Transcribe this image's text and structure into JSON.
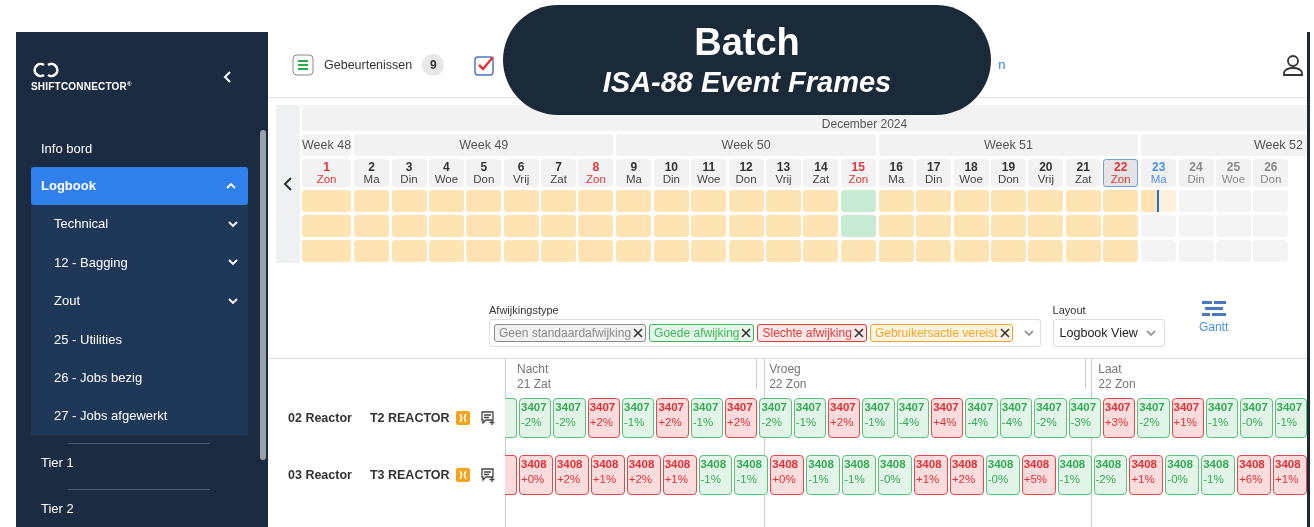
{
  "banner": {
    "title": "Batch",
    "subtitle": "ISA-88 Event Frames"
  },
  "sidebar": {
    "logo": "SHIFTCONNECTOR$^{®}$",
    "items": [
      {
        "label": "Info bord",
        "selected": false
      },
      {
        "label": "Logbook",
        "selected": true,
        "expanded": true,
        "children": [
          {
            "label": "Technical",
            "expandable": true
          },
          {
            "label": "12 - Bagging",
            "expandable": true
          },
          {
            "label": "Zout",
            "expandable": true
          },
          {
            "label": "25 - Utilities",
            "expandable": false
          },
          {
            "label": "26 - Jobs bezig",
            "expandable": false
          },
          {
            "label": "27 - Jobs afgewerkt",
            "expandable": false
          }
        ]
      },
      {
        "label": "Tier 1",
        "selected": false
      },
      {
        "label": "Tier 2",
        "selected": false
      }
    ]
  },
  "toolbar": {
    "events": {
      "label": "Gebeurtenissen",
      "count": "9"
    },
    "link_fragment": "n"
  },
  "calendar": {
    "month": "December 2024",
    "weeks": [
      {
        "label": "Week 48",
        "days": [
          {
            "num": "1",
            "name": "Zon",
            "kind": "sunday",
            "selected": false,
            "cells": [
              {
                "color": "#fee3b3"
              },
              {
                "color": "#fee3b3"
              },
              {
                "color": "#fee3b3"
              }
            ]
          }
        ]
      },
      {
        "label": "Week 49",
        "days": [
          {
            "num": "2",
            "name": "Ma",
            "kind": "weekday",
            "selected": false,
            "cells": [
              {
                "color": "#fee3b3"
              },
              {
                "color": "#fee3b3"
              },
              {
                "color": "#fee3b3"
              }
            ]
          },
          {
            "num": "3",
            "name": "Din",
            "kind": "weekday",
            "selected": false,
            "cells": [
              {
                "color": "#fee3b3"
              },
              {
                "color": "#fee3b3"
              },
              {
                "color": "#fee3b3"
              }
            ]
          },
          {
            "num": "4",
            "name": "Woe",
            "kind": "weekday",
            "selected": false,
            "cells": [
              {
                "color": "#fee3b3"
              },
              {
                "color": "#fee3b3"
              },
              {
                "color": "#fee3b3"
              }
            ]
          },
          {
            "num": "5",
            "name": "Don",
            "kind": "weekday",
            "selected": false,
            "cells": [
              {
                "color": "#fee3b3"
              },
              {
                "color": "#fee3b3"
              },
              {
                "color": "#fee3b3"
              }
            ]
          },
          {
            "num": "6",
            "name": "Vrij",
            "kind": "weekday",
            "selected": false,
            "cells": [
              {
                "color": "#fee3b3"
              },
              {
                "color": "#fee3b3"
              },
              {
                "color": "#fee3b3"
              }
            ]
          },
          {
            "num": "7",
            "name": "Zat",
            "kind": "weekday",
            "selected": false,
            "cells": [
              {
                "color": "#fee3b3"
              },
              {
                "color": "#fee3b3"
              },
              {
                "color": "#fee3b3"
              }
            ]
          },
          {
            "num": "8",
            "name": "Zon",
            "kind": "sunday",
            "selected": false,
            "cells": [
              {
                "color": "#fee3b3"
              },
              {
                "color": "#fee3b3"
              },
              {
                "color": "#fee3b3"
              }
            ]
          }
        ]
      },
      {
        "label": "Week 50",
        "days": [
          {
            "num": "9",
            "name": "Ma",
            "kind": "weekday",
            "selected": false,
            "cells": [
              {
                "color": "#fee3b3"
              },
              {
                "color": "#fee3b3"
              },
              {
                "color": "#fee3b3"
              }
            ]
          },
          {
            "num": "10",
            "name": "Din",
            "kind": "weekday",
            "selected": false,
            "cells": [
              {
                "color": "#fee3b3"
              },
              {
                "color": "#fee3b3"
              },
              {
                "color": "#fee3b3"
              }
            ]
          },
          {
            "num": "11",
            "name": "Woe",
            "kind": "weekday",
            "selected": false,
            "cells": [
              {
                "color": "#fee3b3"
              },
              {
                "color": "#fee3b3"
              },
              {
                "color": "#fee3b3"
              }
            ]
          },
          {
            "num": "12",
            "name": "Don",
            "kind": "weekday",
            "selected": false,
            "cells": [
              {
                "color": "#fee3b3"
              },
              {
                "color": "#fee3b3"
              },
              {
                "color": "#fee3b3"
              }
            ]
          },
          {
            "num": "13",
            "name": "Vrij",
            "kind": "weekday",
            "selected": false,
            "cells": [
              {
                "color": "#fee3b3"
              },
              {
                "color": "#fee3b3"
              },
              {
                "color": "#fee3b3"
              }
            ]
          },
          {
            "num": "14",
            "name": "Zat",
            "kind": "weekday",
            "selected": false,
            "cells": [
              {
                "color": "#fee3b3"
              },
              {
                "color": "#fee3b3"
              },
              {
                "color": "#fee3b3"
              }
            ]
          },
          {
            "num": "15",
            "name": "Zon",
            "kind": "sunday",
            "selected": false,
            "cells": [
              {
                "color": "#c6ead2"
              },
              {
                "color": "#c6ead2"
              },
              {
                "color": "#fee3b3"
              }
            ]
          }
        ]
      },
      {
        "label": "Week 51",
        "days": [
          {
            "num": "16",
            "name": "Ma",
            "kind": "weekday",
            "selected": false,
            "cells": [
              {
                "color": "#fee3b3"
              },
              {
                "color": "#fee3b3"
              },
              {
                "color": "#fee3b3"
              }
            ]
          },
          {
            "num": "17",
            "name": "Din",
            "kind": "weekday",
            "selected": false,
            "cells": [
              {
                "color": "#fee3b3"
              },
              {
                "color": "#fee3b3"
              },
              {
                "color": "#fee3b3"
              }
            ]
          },
          {
            "num": "18",
            "name": "Woe",
            "kind": "weekday",
            "selected": false,
            "cells": [
              {
                "color": "#fee3b3"
              },
              {
                "color": "#fee3b3"
              },
              {
                "color": "#fee3b3"
              }
            ]
          },
          {
            "num": "19",
            "name": "Don",
            "kind": "weekday",
            "selected": false,
            "cells": [
              {
                "color": "#fee3b3"
              },
              {
                "color": "#fee3b3"
              },
              {
                "color": "#fee3b3"
              }
            ]
          },
          {
            "num": "20",
            "name": "Vrij",
            "kind": "weekday",
            "selected": false,
            "cells": [
              {
                "color": "#fee3b3"
              },
              {
                "color": "#fee3b3"
              },
              {
                "color": "#fee3b3"
              }
            ]
          },
          {
            "num": "21",
            "name": "Zat",
            "kind": "weekday",
            "selected": false,
            "cells": [
              {
                "color": "#fee3b3"
              },
              {
                "color": "#fee3b3"
              },
              {
                "color": "#fee3b3"
              }
            ]
          },
          {
            "num": "22",
            "name": "Zon",
            "kind": "sunday",
            "selected": true,
            "cells": [
              {
                "color": "#fee3b3"
              },
              {
                "color": "#fee3b3"
              },
              {
                "color": "#fee3b3"
              }
            ]
          }
        ]
      },
      {
        "label": "Week 52",
        "days": [
          {
            "num": "23",
            "name": "Ma",
            "kind": "today",
            "selected": false,
            "cells": [
              {
                "color": "#fee3b3",
                "level": 0.5
              },
              {
                "color": "#f4f4f4"
              },
              {
                "color": "#f4f4f4"
              }
            ]
          },
          {
            "num": "24",
            "name": "Din",
            "kind": "future",
            "selected": false,
            "cells": [
              {
                "color": "#f4f4f4"
              },
              {
                "color": "#f4f4f4"
              },
              {
                "color": "#f4f4f4"
              }
            ]
          },
          {
            "num": "25",
            "name": "Woe",
            "kind": "future",
            "selected": false,
            "cells": [
              {
                "color": "#f4f4f4"
              },
              {
                "color": "#f4f4f4"
              },
              {
                "color": "#f4f4f4"
              }
            ]
          },
          {
            "num": "26",
            "name": "Don",
            "kind": "future",
            "selected": false,
            "cells": [
              {
                "color": "#f4f4f4"
              },
              {
                "color": "#f4f4f4"
              },
              {
                "color": "#f4f4f4"
              }
            ]
          }
        ]
      }
    ]
  },
  "filter": {
    "label": "Afwijkingstype",
    "tags": [
      {
        "label": "Geen standaardafwijking",
        "color": "#8a8a8a"
      },
      {
        "label": "Goede afwijking",
        "color": "#3cb95a"
      },
      {
        "label": "Slechte afwijking",
        "color": "#e03a3a"
      },
      {
        "label": "Gebruikersactie vereist",
        "color": "#f5a524"
      }
    ]
  },
  "layout": {
    "label": "Layout",
    "value": "Logbook View"
  },
  "view_button": "Gantt",
  "timeline": {
    "shifts": [
      {
        "name": "Nacht",
        "date": "21 Zat"
      },
      {
        "name": "Vroeg",
        "date": "22 Zon"
      },
      {
        "name": "Laat",
        "date": "22 Zon"
      }
    ],
    "rows": [
      {
        "area": "02 Reactor",
        "unit": "T2 REACTOR",
        "lead": {
          "kind": "good"
        },
        "batches": [
          {
            "id": "3407",
            "delta": "-2%",
            "kind": "good"
          },
          {
            "id": "3407",
            "delta": "-2%",
            "kind": "good"
          },
          {
            "id": "3407",
            "delta": "+2%",
            "kind": "bad"
          },
          {
            "id": "3407",
            "delta": "-1%",
            "kind": "good"
          },
          {
            "id": "3407",
            "delta": "+2%",
            "kind": "bad"
          },
          {
            "id": "3407",
            "delta": "-1%",
            "kind": "good"
          },
          {
            "id": "3407",
            "delta": "+2%",
            "kind": "bad"
          },
          {
            "id": "3407",
            "delta": "-2%",
            "kind": "good"
          },
          {
            "id": "3407",
            "delta": "-1%",
            "kind": "good"
          },
          {
            "id": "3407",
            "delta": "+2%",
            "kind": "bad"
          },
          {
            "id": "3407",
            "delta": "-1%",
            "kind": "good"
          },
          {
            "id": "3407",
            "delta": "-4%",
            "kind": "good"
          },
          {
            "id": "3407",
            "delta": "+4%",
            "kind": "bad"
          },
          {
            "id": "3407",
            "delta": "-4%",
            "kind": "good"
          },
          {
            "id": "3407",
            "delta": "-4%",
            "kind": "good"
          },
          {
            "id": "3407",
            "delta": "-2%",
            "kind": "good"
          },
          {
            "id": "3407",
            "delta": "-3%",
            "kind": "good"
          },
          {
            "id": "3407",
            "delta": "+3%",
            "kind": "bad"
          },
          {
            "id": "3407",
            "delta": "-2%",
            "kind": "good"
          },
          {
            "id": "3407",
            "delta": "+1%",
            "kind": "bad"
          },
          {
            "id": "3407",
            "delta": "-1%",
            "kind": "good"
          },
          {
            "id": "3407",
            "delta": "-0%",
            "kind": "good"
          },
          {
            "id": "3407",
            "delta": "-1%",
            "kind": "good"
          }
        ]
      },
      {
        "area": "03 Reactor",
        "unit": "T3 REACTOR",
        "lead": {
          "kind": "bad"
        },
        "batches": [
          {
            "id": "3408",
            "delta": "+0%",
            "kind": "bad"
          },
          {
            "id": "3408",
            "delta": "+2%",
            "kind": "bad"
          },
          {
            "id": "3408",
            "delta": "+1%",
            "kind": "bad"
          },
          {
            "id": "3408",
            "delta": "+2%",
            "kind": "bad"
          },
          {
            "id": "3408",
            "delta": "+1%",
            "kind": "bad"
          },
          {
            "id": "3408",
            "delta": "-1%",
            "kind": "good"
          },
          {
            "id": "3408",
            "delta": "-1%",
            "kind": "good"
          },
          {
            "id": "3408",
            "delta": "+0%",
            "kind": "bad"
          },
          {
            "id": "3408",
            "delta": "-1%",
            "kind": "good"
          },
          {
            "id": "3408",
            "delta": "-1%",
            "kind": "good"
          },
          {
            "id": "3408",
            "delta": "-0%",
            "kind": "good"
          },
          {
            "id": "3408",
            "delta": "+1%",
            "kind": "bad"
          },
          {
            "id": "3408",
            "delta": "+2%",
            "kind": "bad"
          },
          {
            "id": "3408",
            "delta": "-0%",
            "kind": "good"
          },
          {
            "id": "3408",
            "delta": "+5%",
            "kind": "bad"
          },
          {
            "id": "3408",
            "delta": "-1%",
            "kind": "good"
          },
          {
            "id": "3408",
            "delta": "-2%",
            "kind": "good"
          },
          {
            "id": "3408",
            "delta": "+1%",
            "kind": "bad"
          },
          {
            "id": "3408",
            "delta": "-0%",
            "kind": "good"
          },
          {
            "id": "3408",
            "delta": "-1%",
            "kind": "good"
          },
          {
            "id": "3408",
            "delta": "+6%",
            "kind": "bad"
          },
          {
            "id": "3408",
            "delta": "+1%",
            "kind": "bad"
          }
        ]
      }
    ]
  }
}
